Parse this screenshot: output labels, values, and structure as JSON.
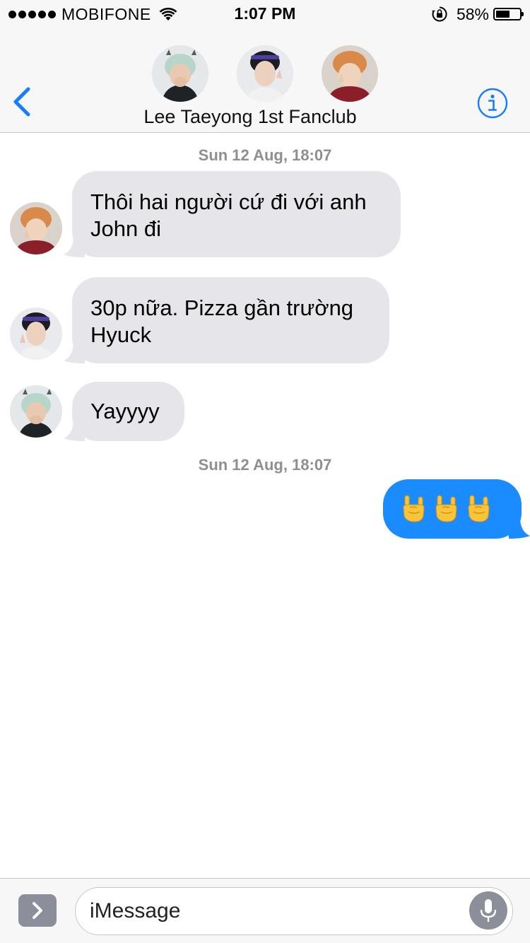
{
  "status_bar": {
    "carrier": "MOBIFONE",
    "time": "1:07 PM",
    "battery_percent_label": "58%",
    "battery_level": 0.58,
    "icons": [
      "signal-dots-icon",
      "wifi-icon",
      "rotation-lock-icon",
      "battery-icon"
    ]
  },
  "header": {
    "title": "Lee Taeyong 1st Fanclub",
    "back_icon": "chevron-left-icon",
    "info_icon": "info-icon",
    "accent_color": "#157efb",
    "participants": [
      "avatar-mint-hair",
      "avatar-dark-hair-headband",
      "avatar-orange-hair"
    ]
  },
  "conversation": {
    "timestamps": [
      {
        "day": "Sun 12 Aug,",
        "time": "18:07"
      },
      {
        "day": "Sun 12 Aug,",
        "time": "18:07"
      }
    ],
    "messages": [
      {
        "direction": "incoming",
        "sender_avatar": "avatar-orange-hair",
        "line1": "Thôi hai người cứ đi với anh",
        "line2": "John đi"
      },
      {
        "direction": "incoming",
        "sender_avatar": "avatar-dark-hair-headband",
        "line1": "30p nữa. Pizza gần trường",
        "line2": "Hyuck"
      },
      {
        "direction": "incoming",
        "sender_avatar": "avatar-mint-hair",
        "line1": "Yayyyy",
        "line2": ""
      },
      {
        "direction": "outgoing",
        "emoji": "🤘🤘🤘",
        "emoji_name": "sign-of-the-horns-icon"
      }
    ],
    "incoming_bubble_color": "#e5e5ea",
    "outgoing_bubble_color": "#1a8cff"
  },
  "input_bar": {
    "placeholder": "iMessage",
    "expand_icon": "chevron-right-icon",
    "mic_icon": "microphone-icon"
  }
}
